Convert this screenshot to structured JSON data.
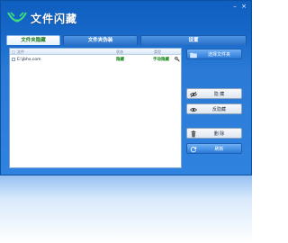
{
  "app": {
    "title": "文件闪藏"
  },
  "window_controls": {
    "minimize": "–",
    "close": "×"
  },
  "tabs": [
    {
      "label": "文件夹隐藏",
      "active": true
    },
    {
      "label": "文件夹伪装",
      "active": false
    },
    {
      "label": "设置",
      "active": false
    }
  ],
  "list": {
    "columns": {
      "check": "□",
      "path": "文件",
      "status": "状态",
      "type": "类型"
    },
    "rows": [
      {
        "checked": false,
        "path": "E:\\jbhx.com",
        "status": "隐藏",
        "type": "手动隐藏"
      }
    ]
  },
  "actions": {
    "select_folder": "选择文件夹",
    "hide": "隐 藏",
    "unhide": "反隐藏",
    "delete": "删 除",
    "refresh": "刷新"
  },
  "colors": {
    "window_blue": "#2a7ad6",
    "status_green": "#1e8a1e",
    "button_blue": "#2b7ad8"
  }
}
